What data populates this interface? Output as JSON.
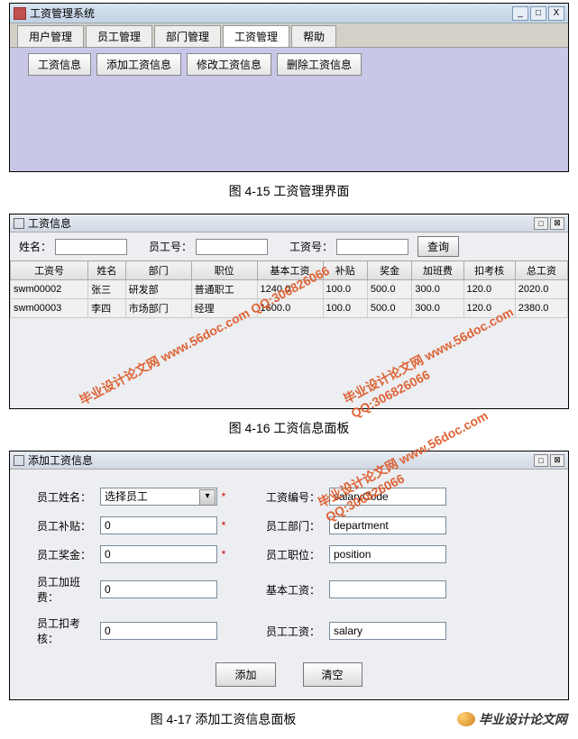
{
  "win1": {
    "title": "工资管理系统",
    "tabs": [
      "用户管理",
      "员工管理",
      "部门管理",
      "工资管理",
      "帮助"
    ],
    "toolbar": [
      "工资信息",
      "添加工资信息",
      "修改工资信息",
      "删除工资信息"
    ]
  },
  "caption1": "图 4-15 工资管理界面",
  "win2": {
    "title": "工资信息",
    "search": {
      "name_lbl": "姓名：",
      "empno_lbl": "员工号：",
      "salno_lbl": "工资号：",
      "btn": "查询"
    },
    "headers": [
      "工资号",
      "姓名",
      "部门",
      "职位",
      "基本工资",
      "补贴",
      "奖金",
      "加班费",
      "扣考核",
      "总工资"
    ],
    "rows": [
      [
        "swm00002",
        "张三",
        "研发部",
        "普通职工",
        "1240.0",
        "100.0",
        "500.0",
        "300.0",
        "120.0",
        "2020.0"
      ],
      [
        "swm00003",
        "李四",
        "市场部门",
        "经理",
        "1600.0",
        "100.0",
        "500.0",
        "300.0",
        "120.0",
        "2380.0"
      ]
    ]
  },
  "caption2": "图 4-16 工资信息面板",
  "win3": {
    "title": "添加工资信息",
    "left": {
      "name": {
        "lbl": "员工姓名：",
        "val": "选择员工"
      },
      "allowance": {
        "lbl": "员工补贴：",
        "val": "0"
      },
      "bonus": {
        "lbl": "员工奖金：",
        "val": "0"
      },
      "overtime": {
        "lbl": "员工加班费：",
        "val": "0"
      },
      "deduct": {
        "lbl": "员工扣考核：",
        "val": "0"
      }
    },
    "right": {
      "code": {
        "lbl": "工资编号：",
        "val": "salaryCode"
      },
      "dept": {
        "lbl": "员工部门：",
        "val": "department"
      },
      "pos": {
        "lbl": "员工职位：",
        "val": "position"
      },
      "base": {
        "lbl": "基本工资：",
        "val": ""
      },
      "total": {
        "lbl": "员工工资：",
        "val": "salary"
      }
    },
    "btns": {
      "add": "添加",
      "clear": "清空"
    }
  },
  "caption3": "图 4-17 添加工资信息面板",
  "logo_text": "毕业设计论文网",
  "wm": "毕业设计论文网\nwww.56doc.com   QQ:306826066"
}
